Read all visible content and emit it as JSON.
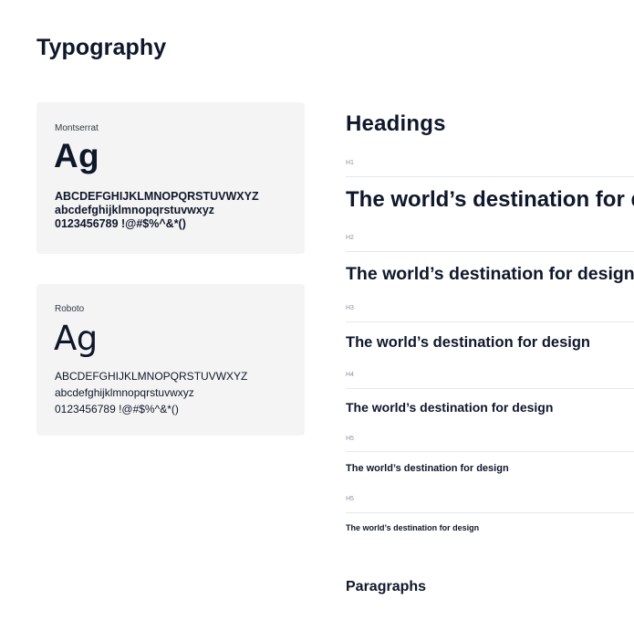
{
  "page": {
    "title": "Typography"
  },
  "fonts": [
    {
      "name": "Montserrat",
      "sample": "Ag",
      "uppercase": "ABCDEFGHIJKLMNOPQRSTUVWXYZ",
      "lowercase": "abcdefghijklmnopqrstuvwxyz",
      "digits_symbols": "0123456789 !@#$%^&*()"
    },
    {
      "name": "Roboto",
      "sample": "Ag",
      "uppercase": "ABCDEFGHIJKLMNOPQRSTUVWXYZ",
      "lowercase": "abcdefghijklmnopqrstuvwxyz",
      "digits_symbols": "0123456789 !@#$%^&*()"
    }
  ],
  "headings": {
    "title": "Headings",
    "levels": [
      {
        "label": "H1",
        "text": "The world’s destination for design"
      },
      {
        "label": "H2",
        "text": "The world’s destination for design"
      },
      {
        "label": "H3",
        "text": "The world’s destination for design"
      },
      {
        "label": "H4",
        "text": "The world’s destination for design"
      },
      {
        "label": "H5",
        "text": "The world’s destination for design"
      },
      {
        "label": "H5",
        "text": "The world’s destination for design"
      }
    ]
  },
  "paragraphs": {
    "title": "Paragraphs"
  },
  "colors": {
    "text": "#0f172a",
    "card_background": "#f4f4f4",
    "divider": "#e5e7eb",
    "label": "#8a919c"
  }
}
